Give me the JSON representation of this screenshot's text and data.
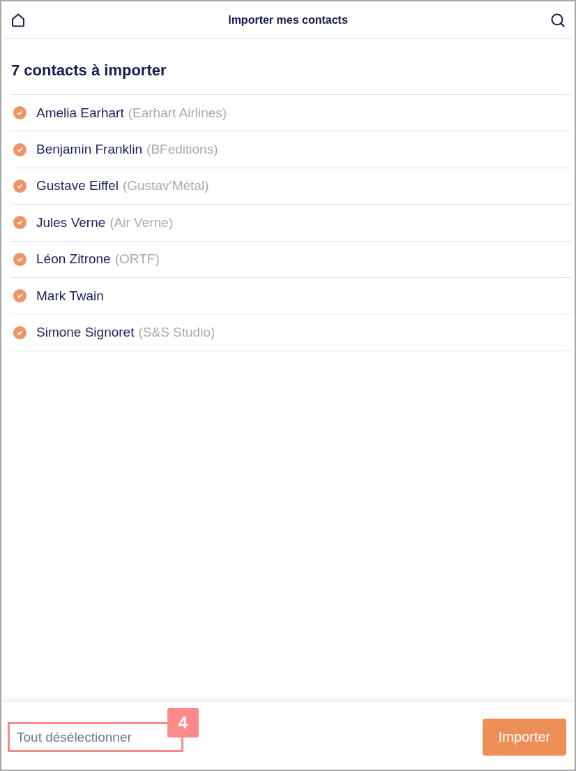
{
  "header": {
    "title": "Importer mes contacts"
  },
  "heading": "7 contacts à importer",
  "contacts": [
    {
      "name": "Amelia Earhart",
      "company": "(Earhart Airlines)",
      "checked": true
    },
    {
      "name": "Benjamin Franklin",
      "company": "(BFeditions)",
      "checked": true
    },
    {
      "name": "Gustave Eiffel",
      "company": "(Gustav’Métal)",
      "checked": true
    },
    {
      "name": "Jules Verne",
      "company": "(Air Verne)",
      "checked": true
    },
    {
      "name": "Léon Zitrone",
      "company": "(ORTF)",
      "checked": true
    },
    {
      "name": "Mark Twain",
      "checked": true
    },
    {
      "name": "Simone Signoret",
      "company": "(S&S Studio)",
      "checked": true
    }
  ],
  "footer": {
    "deselect_button": {
      "label": "Tout désélectionner",
      "callout": "4"
    },
    "import_button": {
      "label": "Importer"
    }
  }
}
